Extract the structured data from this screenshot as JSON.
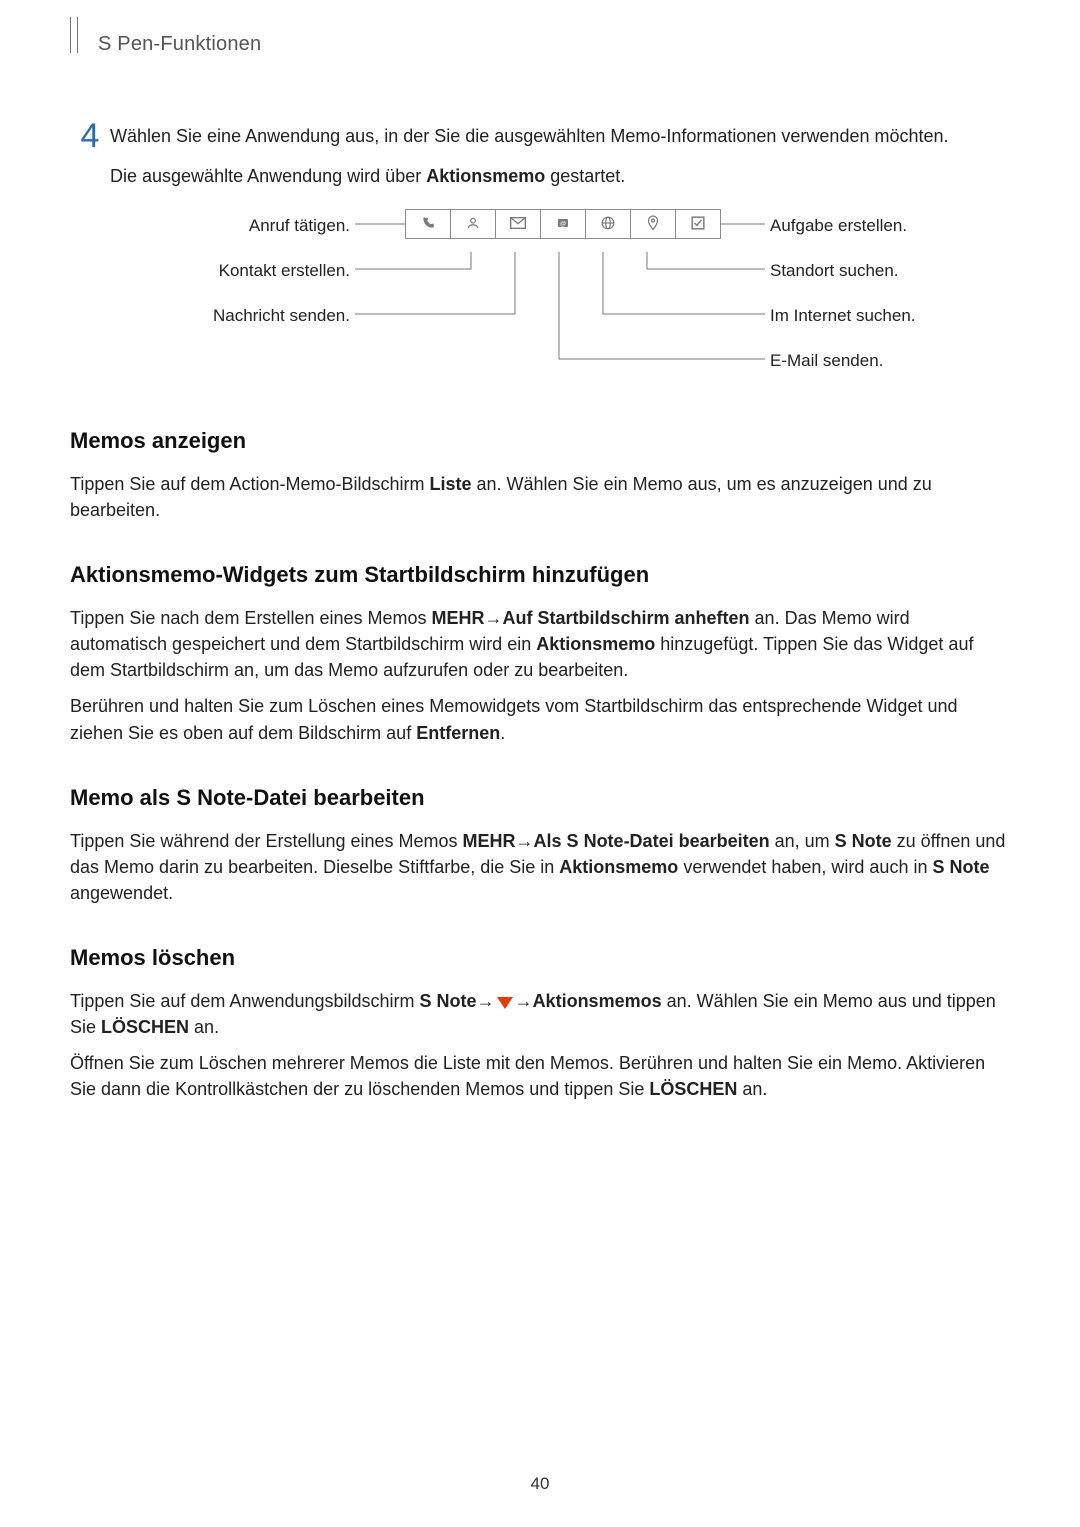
{
  "header": {
    "breadcrumb": "S Pen-Funktionen"
  },
  "step": {
    "number": "4",
    "para1_a": "Wählen Sie eine Anwendung aus, in der Sie die ausgewählten Memo-Informationen verwenden möchten.",
    "para2_a": "Die ausgewählte Anwendung wird über ",
    "para2_bold": "Aktionsmemo",
    "para2_b": " gestartet."
  },
  "diagram": {
    "left": {
      "call": "Anruf tätigen.",
      "contact": "Kontakt erstellen.",
      "message": "Nachricht senden."
    },
    "right": {
      "task": "Aufgabe erstellen.",
      "location": "Standort suchen.",
      "internet": "Im Internet suchen.",
      "email": "E-Mail senden."
    },
    "icons": {
      "phone": "phone-icon",
      "contact": "contact-icon",
      "message": "message-icon",
      "email": "email-icon",
      "web": "web-icon",
      "location": "location-icon",
      "task": "task-icon"
    }
  },
  "sections": {
    "memos_show": {
      "heading": "Memos anzeigen",
      "p1_a": "Tippen Sie auf dem Action-Memo-Bildschirm ",
      "p1_bold": "Liste",
      "p1_b": " an. Wählen Sie ein Memo aus, um es anzuzeigen und zu bearbeiten."
    },
    "widgets": {
      "heading": "Aktionsmemo-Widgets zum Startbildschirm hinzufügen",
      "p1_a": "Tippen Sie nach dem Erstellen eines Memos ",
      "p1_b1": "MEHR",
      "p1_arrow": " → ",
      "p1_b2": "Auf Startbildschirm anheften",
      "p1_c": " an. Das Memo wird automatisch gespeichert und dem Startbildschirm wird ein ",
      "p1_b3": "Aktionsmemo",
      "p1_d": " hinzugefügt. Tippen Sie das Widget auf dem Startbildschirm an, um das Memo aufzurufen oder zu bearbeiten.",
      "p2_a": "Berühren und halten Sie zum Löschen eines Memowidgets vom Startbildschirm das entsprechende Widget und ziehen Sie es oben auf dem Bildschirm auf ",
      "p2_b": "Entfernen",
      "p2_c": "."
    },
    "snote": {
      "heading": "Memo als S Note-Datei bearbeiten",
      "p1_a": "Tippen Sie während der Erstellung eines Memos ",
      "p1_b1": "MEHR",
      "p1_arrow": " → ",
      "p1_b2": "Als S Note-Datei bearbeiten",
      "p1_c": " an, um ",
      "p1_b3": "S Note",
      "p1_d": " zu öffnen und das Memo darin zu bearbeiten. Dieselbe Stiftfarbe, die Sie in ",
      "p1_b4": "Aktionsmemo",
      "p1_e": " verwendet haben, wird auch in ",
      "p1_b5": "S Note",
      "p1_f": " angewendet."
    },
    "delete": {
      "heading": "Memos löschen",
      "p1_a": "Tippen Sie auf dem Anwendungsbildschirm ",
      "p1_b1": "S Note",
      "p1_arrow1": " → ",
      "p1_arrow2": " → ",
      "p1_b2": "Aktionsmemos",
      "p1_c": " an. Wählen Sie ein Memo aus und tippen Sie ",
      "p1_b3": "LÖSCHEN",
      "p1_d": " an.",
      "p2_a": "Öffnen Sie zum Löschen mehrerer Memos die Liste mit den Memos. Berühren und halten Sie ein Memo. Aktivieren Sie dann die Kontrollkästchen der zu löschenden Memos und tippen Sie ",
      "p2_b": "LÖSCHEN",
      "p2_c": " an."
    }
  },
  "page_number": "40"
}
